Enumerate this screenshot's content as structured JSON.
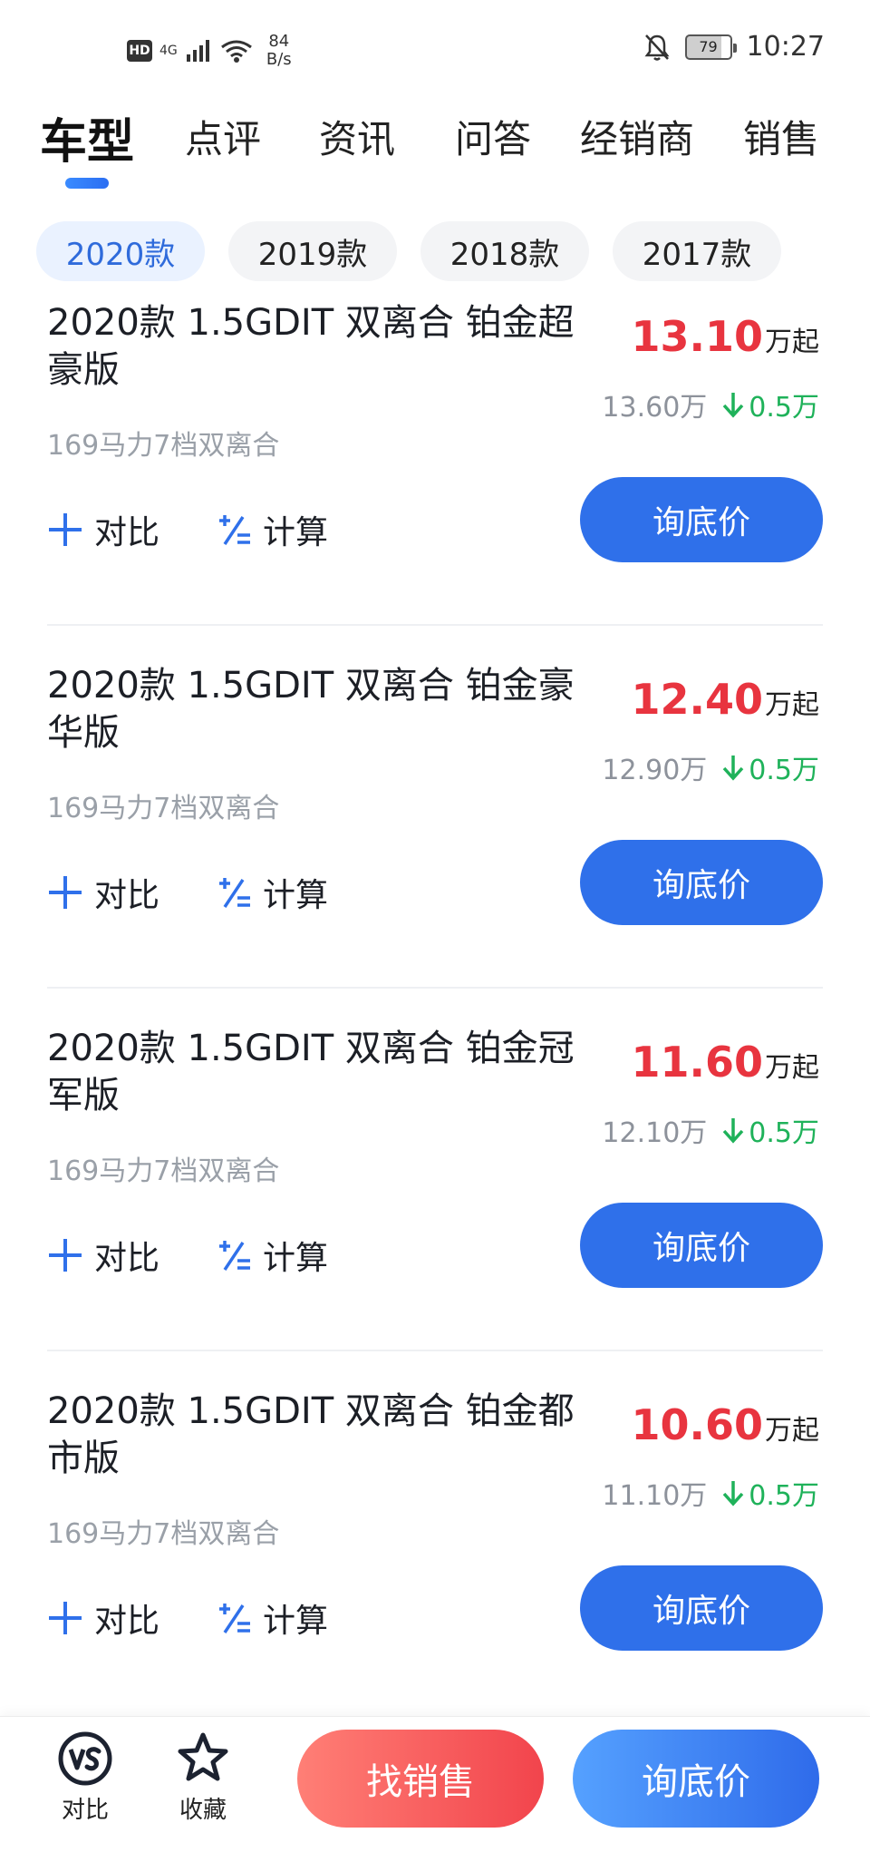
{
  "status_bar": {
    "hd": "HD",
    "network": "4G",
    "speed_value": "84",
    "speed_unit": "B/s",
    "battery": "79",
    "time": "10:27"
  },
  "tabs": [
    {
      "label": "车型",
      "active": true
    },
    {
      "label": "点评",
      "active": false
    },
    {
      "label": "资讯",
      "active": false
    },
    {
      "label": "问答",
      "active": false
    },
    {
      "label": "经销商",
      "active": false
    },
    {
      "label": "销售",
      "active": false
    }
  ],
  "years": [
    {
      "label": "2020款",
      "active": true
    },
    {
      "label": "2019款",
      "active": false
    },
    {
      "label": "2018款",
      "active": false
    },
    {
      "label": "2017款",
      "active": false
    }
  ],
  "items": [
    {
      "title": "2020款 1.5GDIT 双离合 铂金超豪版",
      "price": "13.10",
      "price_unit": "万起",
      "orig_price": "13.60万",
      "drop": "0.5万",
      "spec": "169马力7档双离合"
    },
    {
      "title": "2020款 1.5GDIT 双离合 铂金豪华版",
      "price": "12.40",
      "price_unit": "万起",
      "orig_price": "12.90万",
      "drop": "0.5万",
      "spec": "169马力7档双离合"
    },
    {
      "title": "2020款 1.5GDIT 双离合 铂金冠军版",
      "price": "11.60",
      "price_unit": "万起",
      "orig_price": "12.10万",
      "drop": "0.5万",
      "spec": "169马力7档双离合"
    },
    {
      "title": "2020款 1.5GDIT 双离合 铂金都市版",
      "price": "10.60",
      "price_unit": "万起",
      "orig_price": "11.10万",
      "drop": "0.5万",
      "spec": "169马力7档双离合"
    }
  ],
  "actions": {
    "compare": "对比",
    "calc": "计算",
    "inquire": "询底价"
  },
  "bottom": {
    "compare": "对比",
    "favorite": "收藏",
    "find_sales": "找销售",
    "inquire": "询底价"
  },
  "colors": {
    "accent_blue": "#2f70ea",
    "price_red": "#e8343f",
    "drop_green": "#1fb25a"
  }
}
